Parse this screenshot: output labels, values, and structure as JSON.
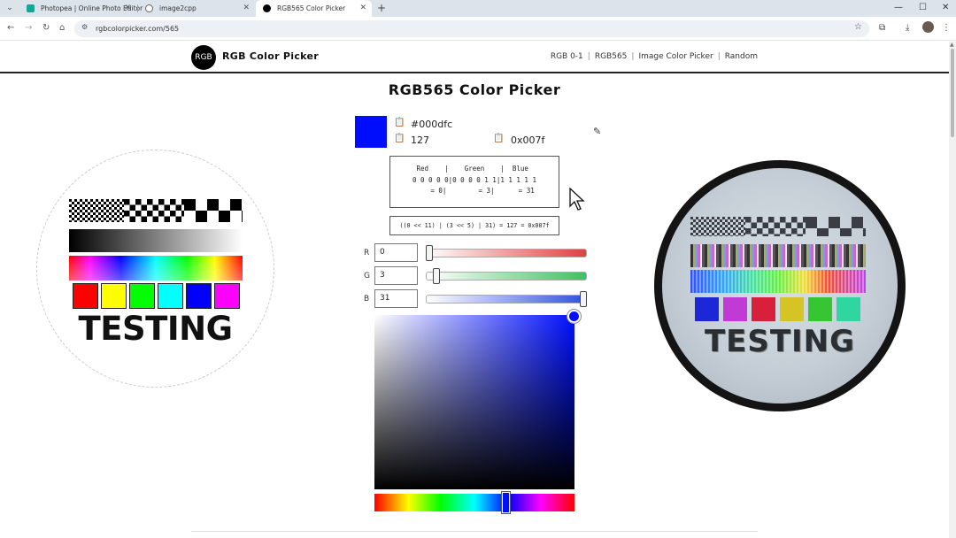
{
  "browser": {
    "tabs": [
      {
        "title": "Photopea | Online Photo Editor",
        "favicon_color": "#18a497",
        "active": false
      },
      {
        "title": "image2cpp",
        "favicon_color": "#666666",
        "active": false
      },
      {
        "title": "RGB565 Color Picker",
        "favicon_color": "#000000",
        "active": true
      }
    ],
    "new_tab_symbol": "+",
    "url": "rgbcolorpicker.com/565"
  },
  "site": {
    "logo_text": "RGB",
    "brand": "RGB Color Picker",
    "nav": [
      "RGB 0-1",
      "RGB565",
      "Image Color Picker",
      "Random"
    ]
  },
  "main": {
    "title": "RGB565 Color Picker",
    "swatch_color": "#000dfc",
    "hex_value": "#000dfc",
    "decimal_value": "127",
    "hex565_value": "0x007f",
    "bits": {
      "line1": "Red    |    Green    |  Blue ",
      "line2": "0 0 0 0 0|0 0 0 0 1 1|1 1 1 1 1",
      "line3": "    = 0|        = 3|      = 31"
    },
    "formula": "((0 << 11) | (3 << 5) | 31) = 127 = 0x007f",
    "channels": [
      {
        "label": "R",
        "value": "0",
        "level": 0.0,
        "max": 31
      },
      {
        "label": "G",
        "value": "3",
        "level": 0.048,
        "max": 63
      },
      {
        "label": "B",
        "value": "31",
        "level": 1.0,
        "max": 31
      }
    ]
  },
  "left_image": {
    "caption": "TESTING",
    "square_colors": [
      "#ff0000",
      "#ffff00",
      "#00ff00",
      "#00ffff",
      "#0000ff",
      "#ff00ff"
    ]
  },
  "right_image": {
    "caption": "TESTING",
    "square_colors": [
      "#1c28d8",
      "#c23ad6",
      "#d8203a",
      "#d6c425",
      "#37c534",
      "#2fd6a0"
    ]
  },
  "icons": [
    "chrome-menu-icon",
    "back-icon",
    "forward-icon",
    "reload-icon",
    "home-icon",
    "site-info-icon",
    "bookmark-star-icon",
    "extensions-icon",
    "download-icon",
    "profile-avatar-icon",
    "more-menu-icon",
    "clipboard-icon",
    "eyedropper-icon"
  ]
}
